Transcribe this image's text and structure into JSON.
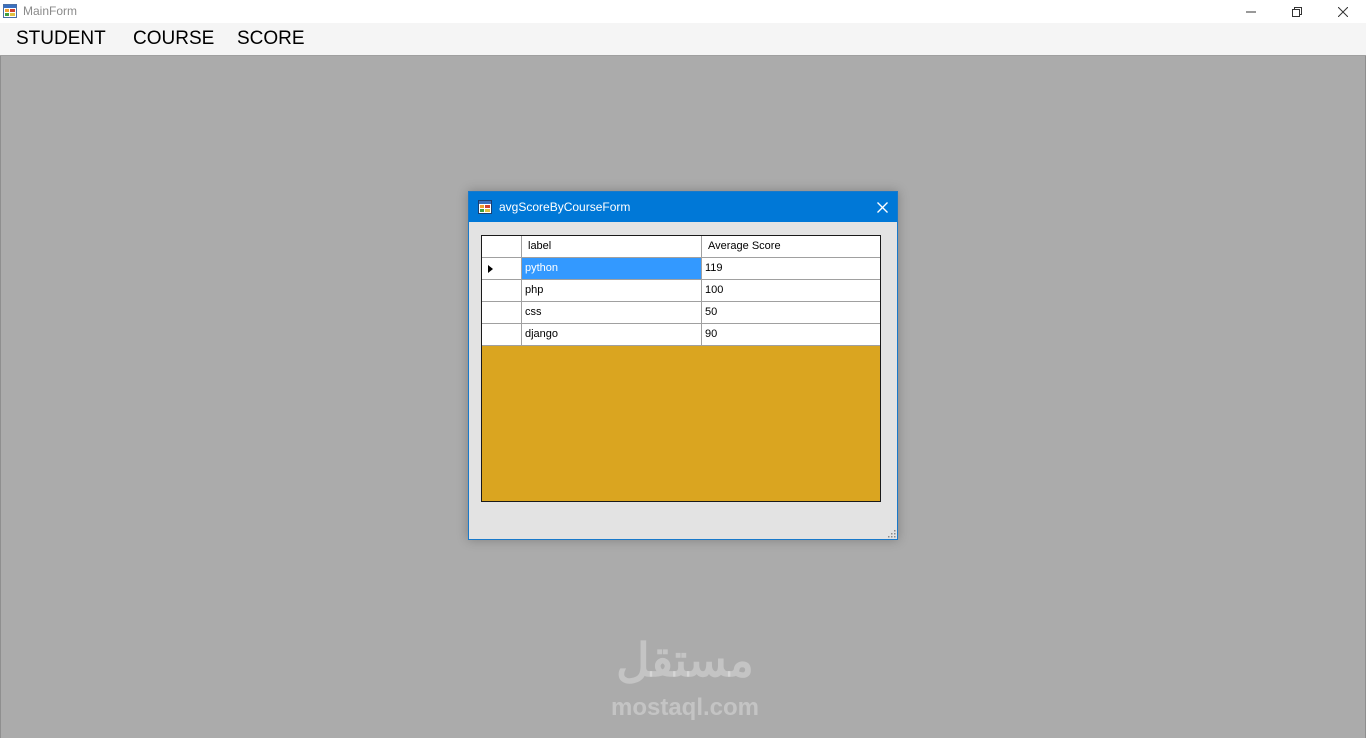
{
  "window": {
    "title": "MainForm",
    "minimize_glyph": "—",
    "restore_glyph": "❐",
    "close_glyph": "✕"
  },
  "menu": {
    "items": [
      {
        "label": "STUDENT"
      },
      {
        "label": "COURSE"
      },
      {
        "label": "SCORE"
      }
    ]
  },
  "dialog": {
    "title": "avgScoreByCourseForm",
    "grid": {
      "columns": [
        "label",
        "Average Score"
      ],
      "rows": [
        {
          "label": "python",
          "score": "119",
          "selected": true
        },
        {
          "label": "php",
          "score": "100",
          "selected": false
        },
        {
          "label": "css",
          "score": "50",
          "selected": false
        },
        {
          "label": "django",
          "score": "90",
          "selected": false
        }
      ],
      "background_color": "#daa520",
      "selection_color": "#3399ff"
    }
  },
  "watermark": {
    "arabic": "مستقل",
    "latin": "mostaql.com"
  },
  "colors": {
    "mdi_background": "#ababab",
    "dialog_titlebar": "#0078d7"
  },
  "icons": {
    "app": "app-window-icon",
    "close": "close-icon",
    "row_indicator": "row-pointer-icon",
    "resize": "resize-grip-icon"
  }
}
